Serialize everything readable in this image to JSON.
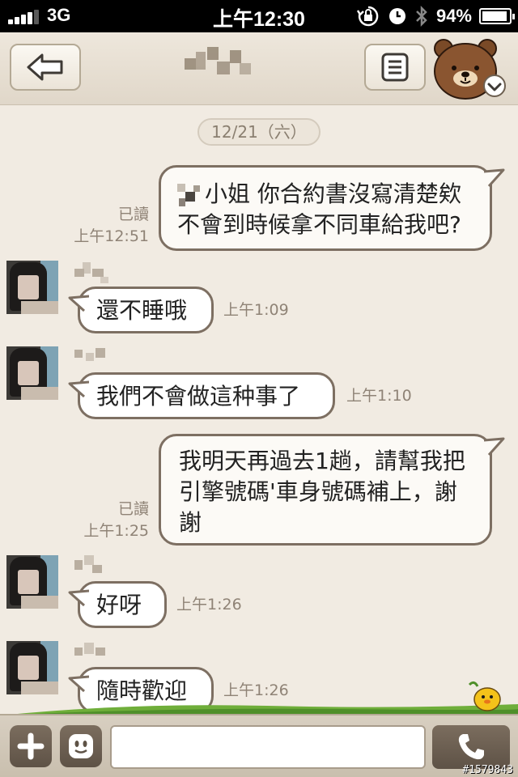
{
  "status_bar": {
    "carrier": "3G",
    "time": "上午12:30",
    "battery_percent": "94%",
    "battery_level": 0.94
  },
  "header": {
    "back_icon": "back-arrow-icon",
    "menu_icon": "list-icon",
    "mascot_icon": "brown-bear-icon"
  },
  "chat": {
    "date": "12/21（六）",
    "messages": [
      {
        "direction": "out",
        "lines": [
          "小姐 你合約書沒寫清楚欸",
          "不會到時候拿不同車給我吧?"
        ],
        "read": "已讀",
        "time": "上午12:51"
      },
      {
        "direction": "in",
        "lines": [
          "還不睡哦"
        ],
        "time": "上午1:09"
      },
      {
        "direction": "in",
        "lines": [
          "我們不會做這种事了"
        ],
        "time": "上午1:10"
      },
      {
        "direction": "out",
        "lines": [
          "我明天再過去1趟，請幫我把",
          "引擎號碼'車身號碼補上，謝",
          "謝"
        ],
        "read": "已讀",
        "time": "上午1:25"
      },
      {
        "direction": "in",
        "lines": [
          "好呀"
        ],
        "time": "上午1:26"
      },
      {
        "direction": "in",
        "lines": [
          "隨時歡迎"
        ],
        "time": "上午1:26"
      }
    ]
  },
  "input": {
    "placeholder": "",
    "value": ""
  },
  "bottom_bar": {
    "add_icon": "plus-icon",
    "sticker_icon": "smiley-icon",
    "call_icon": "phone-icon"
  },
  "watermark": "#1579843"
}
